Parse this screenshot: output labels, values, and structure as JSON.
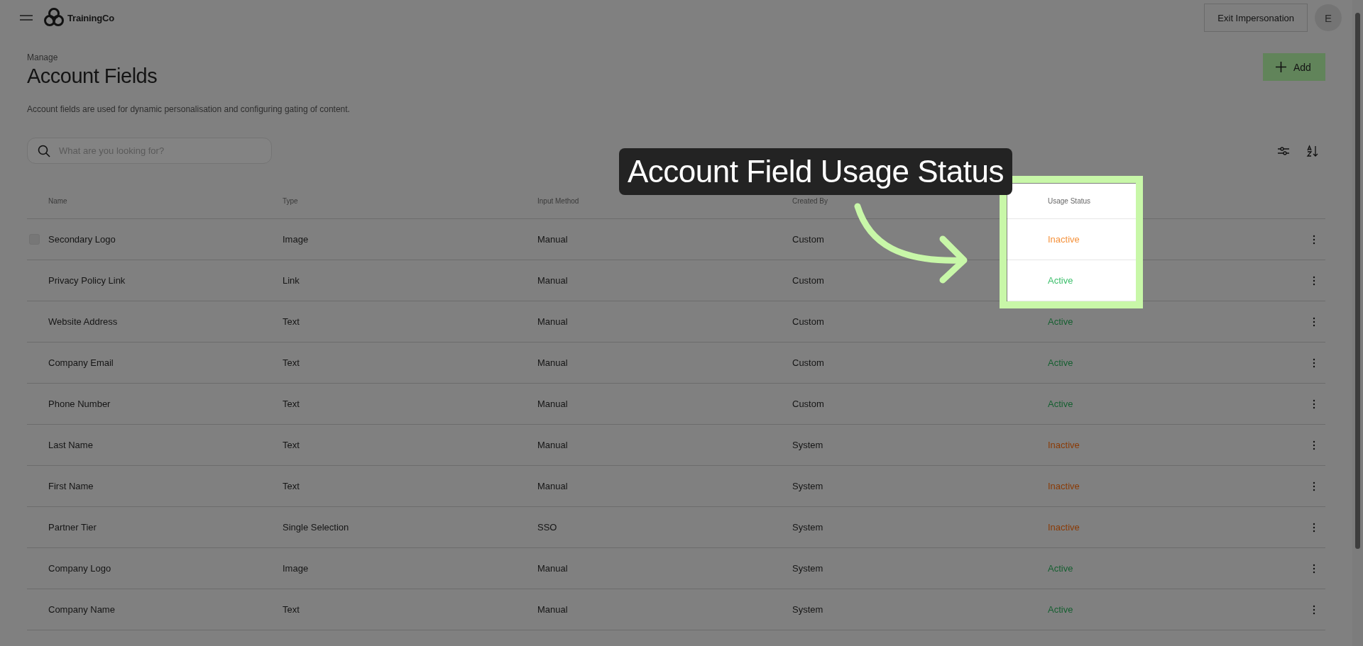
{
  "header": {
    "brand": "TrainingCo",
    "exit_button": "Exit Impersonation",
    "avatar": "E"
  },
  "page": {
    "breadcrumb": "Manage",
    "title": "Account Fields",
    "description": "Account fields are used for dynamic personalisation and configuring gating of content.",
    "add_button": "Add"
  },
  "search": {
    "placeholder": "What are you looking for?"
  },
  "table": {
    "columns": [
      {
        "label": "Name",
        "highlighted": false
      },
      {
        "label": "Type",
        "highlighted": false
      },
      {
        "label": "Input Method",
        "highlighted": false
      },
      {
        "label": "Created By",
        "highlighted": false
      },
      {
        "label": "Usage Status",
        "highlighted": true
      }
    ],
    "rows": [
      {
        "name": "Secondary Logo",
        "type": "Image",
        "input_method": "Manual",
        "created_by": "Custom",
        "usage_status": "Inactive",
        "active": false,
        "hovered": true,
        "highlighted": true
      },
      {
        "name": "Privacy Policy Link",
        "type": "Link",
        "input_method": "Manual",
        "created_by": "Custom",
        "usage_status": "Active",
        "active": true,
        "hovered": false,
        "highlighted": true
      },
      {
        "name": "Website Address",
        "type": "Text",
        "input_method": "Manual",
        "created_by": "Custom",
        "usage_status": "Active",
        "active": true,
        "hovered": false,
        "highlighted": false
      },
      {
        "name": "Company Email",
        "type": "Text",
        "input_method": "Manual",
        "created_by": "Custom",
        "usage_status": "Active",
        "active": true,
        "hovered": false,
        "highlighted": false
      },
      {
        "name": "Phone Number",
        "type": "Text",
        "input_method": "Manual",
        "created_by": "Custom",
        "usage_status": "Active",
        "active": true,
        "hovered": false,
        "highlighted": false
      },
      {
        "name": "Last Name",
        "type": "Text",
        "input_method": "Manual",
        "created_by": "System",
        "usage_status": "Inactive",
        "active": false,
        "hovered": false,
        "highlighted": false
      },
      {
        "name": "First Name",
        "type": "Text",
        "input_method": "Manual",
        "created_by": "System",
        "usage_status": "Inactive",
        "active": false,
        "hovered": false,
        "highlighted": false
      },
      {
        "name": "Partner Tier",
        "type": "Single Selection",
        "input_method": "SSO",
        "created_by": "System",
        "usage_status": "Inactive",
        "active": false,
        "hovered": false,
        "highlighted": false
      },
      {
        "name": "Company Logo",
        "type": "Image",
        "input_method": "Manual",
        "created_by": "System",
        "usage_status": "Active",
        "active": true,
        "hovered": false,
        "highlighted": false
      },
      {
        "name": "Company Name",
        "type": "Text",
        "input_method": "Manual",
        "created_by": "System",
        "usage_status": "Active",
        "active": true,
        "hovered": false,
        "highlighted": false
      }
    ]
  },
  "tour": {
    "tooltip": "Account Field Usage Status"
  }
}
